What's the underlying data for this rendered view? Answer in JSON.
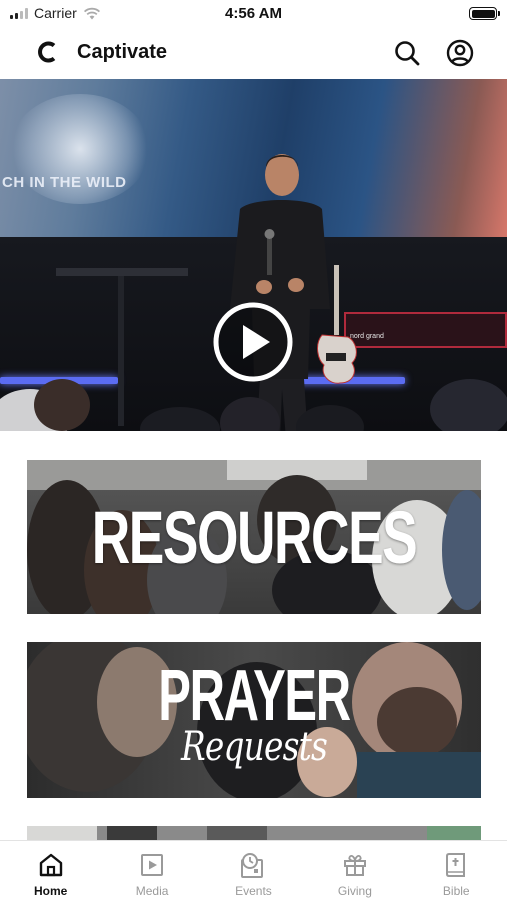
{
  "status_bar": {
    "carrier": "Carrier",
    "time": "4:56 AM",
    "icons": [
      "signal-icon",
      "wifi-icon",
      "battery-icon"
    ]
  },
  "header": {
    "title": "Captivate",
    "logo_icon": "captivate-logo-icon",
    "search_icon": "search-icon",
    "account_icon": "account-icon"
  },
  "hero": {
    "screen_text": "CH IN THE WILD",
    "keyboard_text": "nord grand",
    "play_icon": "play-icon"
  },
  "cards": {
    "resources": {
      "title": "RESOURCES"
    },
    "prayer": {
      "title": "PRAYER",
      "subtitle": "Requests"
    }
  },
  "tabs": [
    {
      "label": "Home",
      "icon": "home-icon",
      "active": true
    },
    {
      "label": "Media",
      "icon": "media-icon",
      "active": false
    },
    {
      "label": "Events",
      "icon": "events-icon",
      "active": false
    },
    {
      "label": "Giving",
      "icon": "gift-icon",
      "active": false
    },
    {
      "label": "Bible",
      "icon": "bible-icon",
      "active": false
    }
  ],
  "colors": {
    "active_tab": "#111111",
    "inactive_tab": "#9a9a9a",
    "stage_light": "#5b6cf2",
    "keyboard_red": "#b02a3c"
  }
}
